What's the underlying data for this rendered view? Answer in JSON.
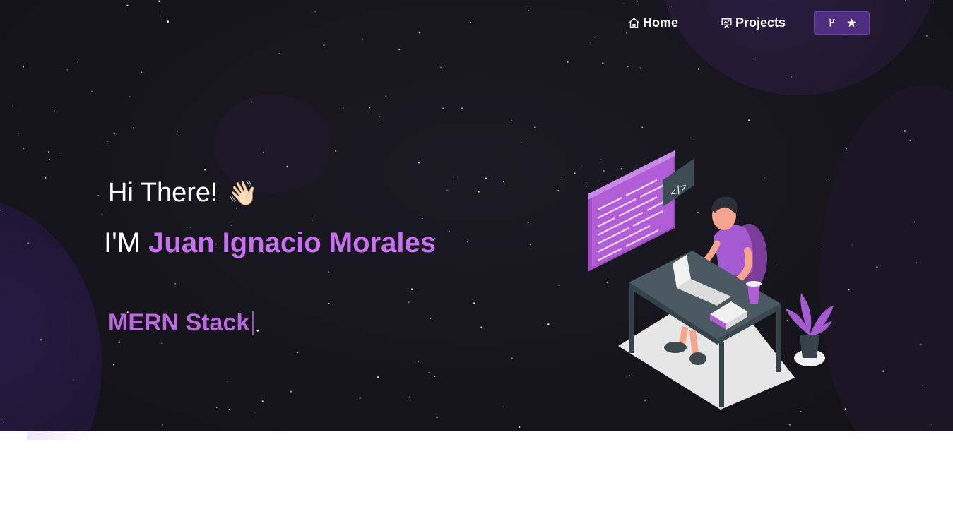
{
  "nav": {
    "home_label": "Home",
    "projects_label": "Projects",
    "home_icon": "home-icon",
    "projects_icon": "presentation-icon",
    "github_icons": [
      "git-fork-icon",
      "star-icon"
    ]
  },
  "hero": {
    "greeting": "Hi There!",
    "wave": "👋🏻",
    "im_prefix": "I'M ",
    "name": "Juan Ignacio Morales",
    "typewriter_text": "MERN Stack"
  },
  "colors": {
    "accent": "#c770f0",
    "button": "#4e2e7e",
    "background": "#15141b"
  }
}
